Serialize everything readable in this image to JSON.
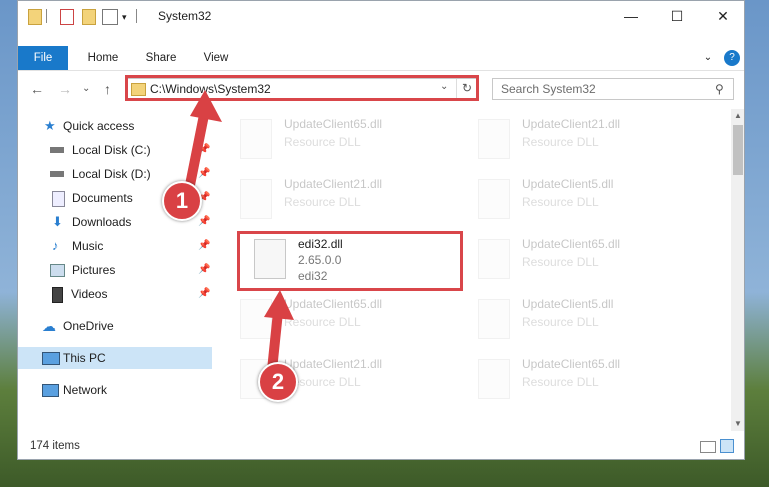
{
  "window": {
    "title": "System32"
  },
  "ribbon": {
    "tabs": [
      "File",
      "Home",
      "Share",
      "View"
    ]
  },
  "address": {
    "path": "C:\\Windows\\System32"
  },
  "search": {
    "placeholder": "Search System32"
  },
  "nav": {
    "items": [
      {
        "label": "Quick access",
        "icon": "star-icon"
      },
      {
        "label": "Local Disk (C:)",
        "icon": "drive-icon"
      },
      {
        "label": "Local Disk (D:)",
        "icon": "drive-icon"
      },
      {
        "label": "Documents",
        "icon": "documents-icon"
      },
      {
        "label": "Downloads",
        "icon": "downloads-icon"
      },
      {
        "label": "Music",
        "icon": "music-icon"
      },
      {
        "label": "Pictures",
        "icon": "pictures-icon"
      },
      {
        "label": "Videos",
        "icon": "videos-icon"
      },
      {
        "label": "OneDrive",
        "icon": "onedrive-icon"
      },
      {
        "label": "This PC",
        "icon": "pc-icon"
      },
      {
        "label": "Network",
        "icon": "network-icon"
      }
    ]
  },
  "files": [
    {
      "name": "UpdateClient65.dll",
      "desc": "Resource DLL"
    },
    {
      "name": "UpdateClient21.dll",
      "desc": "Resource DLL"
    },
    {
      "name": "UpdateClient21.dll",
      "desc": "Resource DLL"
    },
    {
      "name": "UpdateClient5.dll",
      "desc": "Resource DLL"
    },
    {
      "name": "edi32.dll",
      "version": "2.65.0.0",
      "desc": "edi32"
    },
    {
      "name": "UpdateClient65.dll",
      "desc": "Resource DLL"
    },
    {
      "name": "UpdateClient65.dll",
      "desc": "Resource DLL"
    },
    {
      "name": "UpdateClient5.dll",
      "desc": "Resource DLL"
    },
    {
      "name": "UpdateClient21.dll",
      "desc": "Resource DLL"
    },
    {
      "name": "UpdateClient65.dll",
      "desc": "Resource DLL"
    }
  ],
  "status": {
    "count": "174 items"
  },
  "annotations": {
    "step1": "1",
    "step2": "2"
  }
}
